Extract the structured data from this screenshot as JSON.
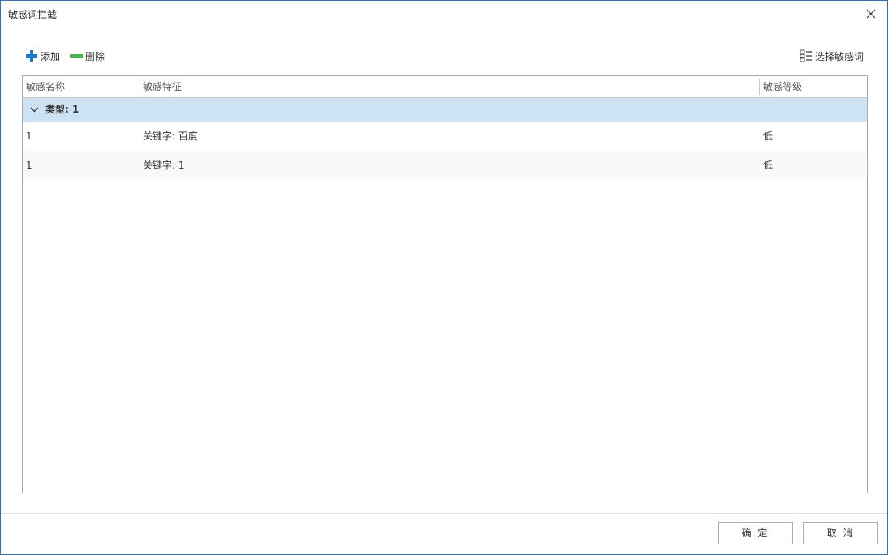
{
  "window": {
    "title": "敏感词拦截"
  },
  "toolbar": {
    "add_label": "添加",
    "delete_label": "删除",
    "select_label": "选择敏感词",
    "add_icon": "plus-icon",
    "delete_icon": "minus-icon",
    "select_icon": "list-icon",
    "add_color": "#1e78c8",
    "delete_color": "#4caf50"
  },
  "grid": {
    "columns": [
      "敏感名称",
      "敏感特征",
      "敏感等级"
    ],
    "groups": [
      {
        "label": "类型: 1",
        "rows": [
          {
            "name": "1",
            "feature": "关键字: 百度",
            "level": "低"
          },
          {
            "name": "1",
            "feature": "关键字: 1",
            "level": "低"
          }
        ]
      }
    ]
  },
  "footer": {
    "ok_label": "确 定",
    "cancel_label": "取 消"
  },
  "colors": {
    "window_border": "#3c6e9e",
    "group_row_bg": "#cde3f5"
  }
}
